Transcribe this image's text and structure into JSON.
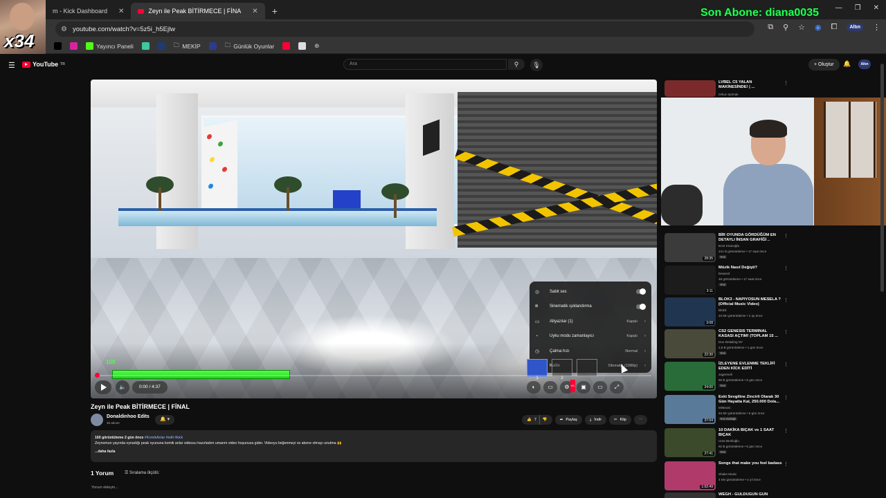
{
  "browser": {
    "tabs": [
      {
        "label": "m - Kick Dashboard",
        "active": false
      },
      {
        "label": "Zeyn ile Peak BİTİRMECE | FİNA",
        "active": true
      }
    ],
    "new_tab": "+",
    "url": "youtube.com/watch?v=5z5i_h5Ejlw",
    "profile_label": "Altın",
    "bookmarks": [
      {
        "label": "Yayıncı Paneli",
        "icon_color": "#53fc18"
      },
      {
        "label": "MEKİP",
        "icon_color": "#cccccc"
      },
      {
        "label": "Günlük Oyunlar",
        "icon_color": "#cccccc"
      }
    ]
  },
  "stream_overlay": {
    "subscriber_text": "Son Abone: diana0035",
    "multiplier": "x34"
  },
  "youtube": {
    "logo_text": "YouTube",
    "logo_region": "TR",
    "search_placeholder": "Ara",
    "create_label": "Oluştur",
    "avatar_label": "Altın"
  },
  "player": {
    "time": "0:00 / 4:37",
    "green_label": "100",
    "thumb_labels": [
      "1",
      "2"
    ],
    "settings": [
      {
        "icon": "stable-volume-icon",
        "label": "Sabit ses",
        "toggle": true
      },
      {
        "icon": "ambient-mode-icon",
        "label": "Sinematik ışıklandırma",
        "toggle": true
      },
      {
        "icon": "subtitles-icon",
        "label": "Altyazılar (1)",
        "value": "Kapalı"
      },
      {
        "icon": "sleep-timer-icon",
        "label": "Uyku modu zamanlayıcı",
        "value": "Kapalı"
      },
      {
        "icon": "speed-icon",
        "label": "Çalma hızı",
        "value": "Normal"
      },
      {
        "icon": "quality-icon",
        "label": "Kalite",
        "value": "Otomatik (1080p)"
      }
    ]
  },
  "video": {
    "title": "Zeyn ile Peak BİTİRMECE | FİNAL",
    "channel": "Donaldinhoo Edits",
    "subscribers": "36 abone",
    "likes": "7",
    "share_label": "Paylaş",
    "download_label": "İndir",
    "clip_label": "Klip",
    "desc_meta": "160 görüntüleme  2 gün önce",
    "desc_tags": "#KomikAnlar #edit #kick",
    "desc_text": "Zeynomun yayında oynadığı peak oyununa komik anlar videosu hazırladım umarım video hoşunuza gider. Videoyu beğenmeyi ve abone olmayı unutma 🙌",
    "desc_more": "...daha fazla",
    "comments_count": "1 Yorum",
    "sort_label": "Sıralama ölçütü:",
    "add_comment": "Yorum ekleyin..."
  },
  "sidebar": {
    "items": [
      {
        "title": "LVBEL C5 YALAN MAKİNESİNDE! | ...",
        "channel": "Orkun Işıtmak",
        "meta": "",
        "duration": "",
        "badge": "",
        "thumb": "#7a2a2a"
      },
      {
        "title": "BİR OYUNDA GÖRDÜĞÜM EN DETAYLI İNSAN GRAFİĞİ ..",
        "channel": "Emir Kiranoğlu",
        "meta": "241 B görüntüleme • 17 saat önce",
        "duration": "28:35",
        "badge": "Yeni",
        "thumb": "#3b3b3b"
      },
      {
        "title": "Müzik Nasıl Değişti?",
        "channel": "beawod",
        "meta": "48 görüntüleme • 17 saat önce",
        "duration": "3:11",
        "badge": "Yeni",
        "thumb": "#1c1c1c"
      },
      {
        "title": "BLOK3 - NAPIYOSUN MESELA ? (Official Music Video)",
        "channel": "Blok3",
        "meta": "34 Mn görüntüleme • 2 ay önce",
        "duration": "3:08",
        "badge": "",
        "thumb": "#20354f"
      },
      {
        "title": "CS2 GENESIS TERMINAL KASASI AÇTIM! (TOPLAM 15 ...",
        "channel": "Duo Detailing NY",
        "meta": "2,6 B görüntüleme • 1 gün önce",
        "duration": "22:30",
        "badge": "Yeni",
        "thumb": "#4a4a3a"
      },
      {
        "title": "İZLEYENE EVLENME TEKLİFİ EDEN KİCK EDİTİ",
        "channel": "Jagermeli",
        "meta": "50 B görüntüleme • 6 gün önce",
        "duration": "24:00",
        "badge": "Yeni",
        "thumb": "#2a6b3a"
      },
      {
        "title": "Eski Sevgiline Zincirli Olarak 30 Gün Hayatta Kal, 250.000 Dola...",
        "channel": "MrBeast",
        "meta": "94 Mn görüntüleme • 6 gün önce",
        "duration": "37:04",
        "badge": "Yeni  Dublajlı",
        "thumb": "#5a7a9a"
      },
      {
        "title": "10 DAKİKA BIÇAK vs 1 SAAT BIÇAK",
        "channel": "Uras Benlioğlu",
        "meta": "92 B görüntüleme • 6 gün önce",
        "duration": "27:41",
        "badge": "Yeni",
        "thumb": "#3a4a2a"
      },
      {
        "title": "Songs that make you feel badass",
        "channel": "Shake Music",
        "meta": "4 Mn görüntüleme • 4 yıl önce",
        "duration": "1:02:49",
        "badge": "",
        "thumb": "#b03a6a"
      },
      {
        "title": "WEGH - GÜLDÜĞÜN GÜN",
        "channel": "",
        "meta": "",
        "duration": "",
        "badge": "",
        "thumb": "#333333"
      }
    ]
  },
  "colors": {
    "accent_red": "#ff0033",
    "progress_green": "#2fe02f",
    "overlay_green": "#22ff55"
  }
}
